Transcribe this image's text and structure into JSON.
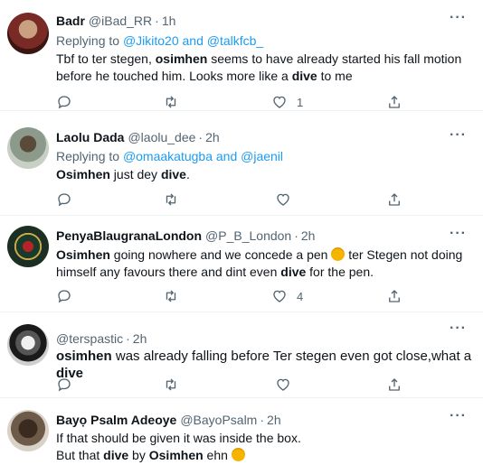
{
  "tweets": [
    {
      "name": "Badr",
      "handle": "@iBad_RR",
      "time": "1h",
      "replying_label": "Replying to",
      "replying_to": "@Jikito20 and @talkfcb_",
      "text": [
        "Tbf to ter stegen, ",
        "osimhen",
        " seems to have already started his fall motion before he touched him. Looks more like a ",
        "dive",
        " to me"
      ],
      "likes": "1"
    },
    {
      "name": "Laolu Dada",
      "handle": "@laolu_dee",
      "time": "2h",
      "replying_label": "Replying to",
      "replying_to": "@omaakatugba and @jaenil",
      "text": [
        "Osimhen",
        " just dey ",
        "dive",
        "."
      ],
      "likes": ""
    },
    {
      "name": "PenyaBlaugranaLondon",
      "handle": "@P_B_London",
      "time": "2h",
      "text": [
        "Osimhen",
        " going nowhere and we concede a pen ",
        " ter Stegen not doing himself any favours there and dint even ",
        "dive",
        " for the pen."
      ],
      "likes": "4"
    },
    {
      "name": "",
      "handle": "@terspastic",
      "time": "2h",
      "text": [
        "osimhen",
        " was already falling before Ter stegen even got close,what a ",
        "dive"
      ],
      "likes": ""
    },
    {
      "name": "Bayọ Psalm Adeoye",
      "handle": "@BayoPsalm",
      "time": "2h",
      "text": [
        "If that should be given it was inside the box.",
        "But that ",
        "dive",
        " by ",
        "Osimhen",
        " ehn "
      ],
      "likes": ""
    }
  ],
  "ui": {
    "more": "···",
    "dot": "·"
  },
  "colors": {
    "accent": "#1d9bf0",
    "secondary": "#536471",
    "border": "#eff3f4"
  }
}
